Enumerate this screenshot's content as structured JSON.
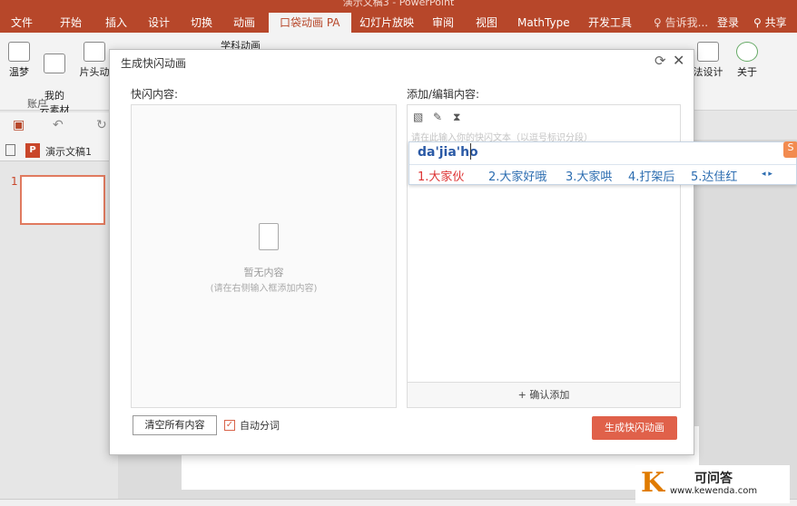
{
  "window": {
    "title": "演示文稿3 - PowerPoint"
  },
  "tabs": [
    {
      "label": "文件"
    },
    {
      "label": "开始"
    },
    {
      "label": "插入"
    },
    {
      "label": "设计"
    },
    {
      "label": "切换"
    },
    {
      "label": "动画"
    },
    {
      "label": "口袋动画 PA"
    },
    {
      "label": "幻灯片放映"
    },
    {
      "label": "审阅"
    },
    {
      "label": "视图"
    },
    {
      "label": "MathType"
    },
    {
      "label": "开发工具"
    }
  ],
  "active_tab": "口袋动画 PA",
  "tell_me": "告诉我...",
  "login": "登录",
  "share": "共享",
  "ribbon": {
    "warm_dream": "温梦",
    "my_cloud": "我的\n云素材",
    "account_group": "账户",
    "title_anim": "片头动",
    "subject_anim": "学科动画",
    "design": "法设计",
    "about": "关于"
  },
  "doc_tab": "演示文稿1",
  "slide_number": "1",
  "dialog": {
    "title": "生成快闪动画",
    "left_label": "快闪内容:",
    "right_label": "添加/编辑内容:",
    "empty_title": "暂无内容",
    "empty_hint": "(请在右侧输入框添加内容)",
    "input_placeholder": "请在此输入你的快闪文本（以逗号标识分段）",
    "add_button": "+ 确认添加",
    "clear_button": "清空所有内容",
    "auto_segment": "自动分词",
    "generate_button": "生成快闪动画"
  },
  "ime": {
    "composition": "da'jia'ho",
    "candidates": [
      "1.大家伙",
      "2.大家好哦",
      "3.大家哄",
      "4.打架后",
      "5.达佳红"
    ]
  },
  "watermark": {
    "brand": "可问答",
    "url": "www.kewenda.com"
  }
}
